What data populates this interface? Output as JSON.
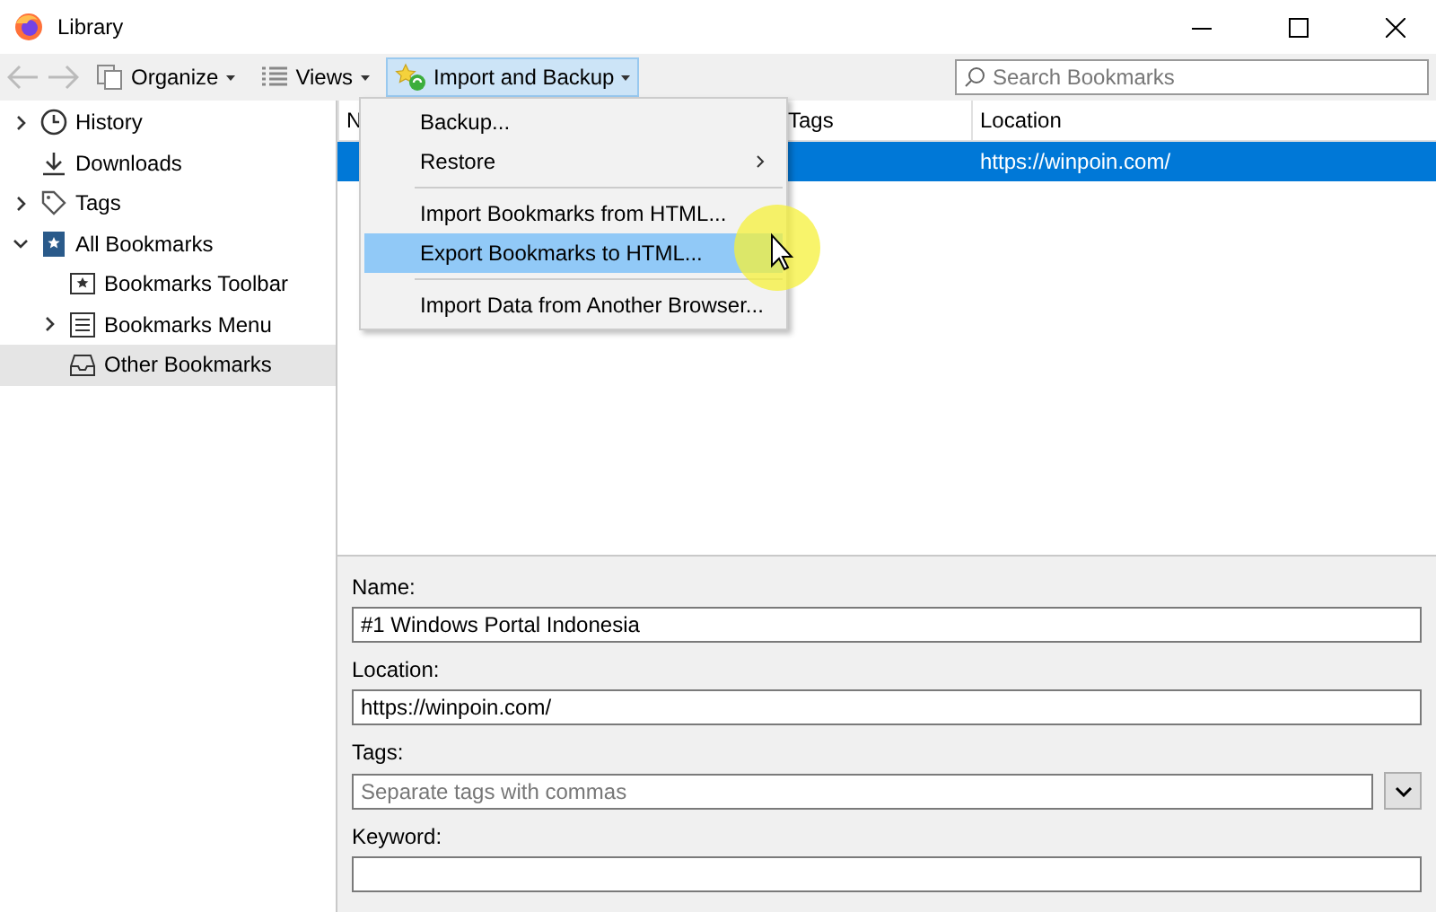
{
  "window": {
    "title": "Library"
  },
  "toolbar": {
    "buttons": [
      {
        "label": "Organize",
        "open": false
      },
      {
        "label": "Views",
        "open": false
      },
      {
        "label": "Import and Backup",
        "open": true
      }
    ],
    "search": {
      "placeholder": "Search Bookmarks"
    }
  },
  "sidebar": {
    "items": [
      {
        "label": "History",
        "expanded": false,
        "selected": false
      },
      {
        "label": "Downloads",
        "selected": false
      },
      {
        "label": "Tags",
        "expanded": false,
        "selected": false
      },
      {
        "label": "All Bookmarks",
        "expanded": true,
        "selected": false,
        "children": [
          {
            "label": "Bookmarks Toolbar",
            "selected": false
          },
          {
            "label": "Bookmarks Menu",
            "expanded": false,
            "selected": false
          },
          {
            "label": "Other Bookmarks",
            "selected": true
          }
        ]
      }
    ]
  },
  "table": {
    "columns": [
      "N",
      "Tags",
      "Location"
    ],
    "rows": [
      {
        "selected": true,
        "location": "https://winpoin.com/"
      }
    ]
  },
  "menu": {
    "items": [
      {
        "label": "Backup...",
        "submenu": false,
        "selected": false,
        "separator_before": false
      },
      {
        "label": "Restore",
        "submenu": true,
        "selected": false,
        "separator_before": false
      },
      {
        "label": "Import Bookmarks from HTML...",
        "submenu": false,
        "selected": false,
        "separator_before": true
      },
      {
        "label": "Export Bookmarks to HTML...",
        "submenu": false,
        "selected": true,
        "separator_before": false
      },
      {
        "label": "Import Data from Another Browser...",
        "submenu": false,
        "selected": false,
        "separator_before": true
      }
    ]
  },
  "details": {
    "fields": [
      {
        "label": "Name:",
        "value": "#1 Windows Portal Indonesia"
      },
      {
        "label": "Location:",
        "value": "https://winpoin.com/"
      },
      {
        "label": "Tags:",
        "placeholder": "Separate tags with commas",
        "dropdown": true
      },
      {
        "label": "Keyword:"
      }
    ]
  }
}
